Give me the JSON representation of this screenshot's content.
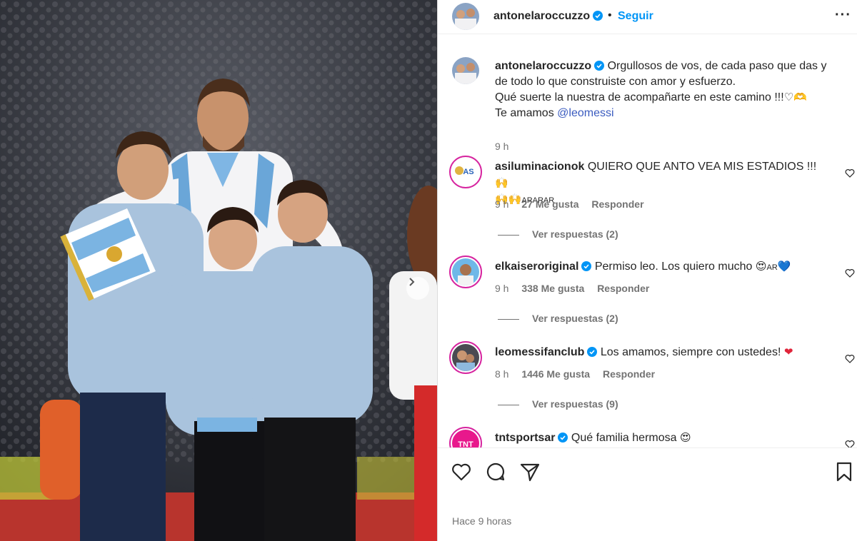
{
  "header": {
    "username": "antonelaroccuzzo",
    "dot": "•",
    "follow_label": "Seguir",
    "more_label": "···"
  },
  "caption": {
    "username": "antonelaroccuzzo",
    "line1": "Orgullosos de vos, de cada paso que das y de todo lo que construiste con amor y esfuerzo.",
    "line2": "Qué suerte la nuestra de acompañarte en este camino !!!",
    "line2_emoji": "♡🫶",
    "line3_prefix": "Te amamos ",
    "mention": "@leomessi",
    "time": "9 h"
  },
  "comments": [
    {
      "username": "asiluminacionok",
      "text": "QUIERO QUE ANTO VEA MIS ESTADIOS !!! ",
      "text2": "ARARAR",
      "time": "9 h",
      "likes": "27 Me gusta",
      "reply": "Responder",
      "replies": "Ver respuestas (2)",
      "avatar_label": "AS"
    },
    {
      "username": "elkaiseroriginal",
      "text": "Permiso leo. Los quiero mucho ",
      "text_suffix": "AR",
      "time": "9 h",
      "likes": "338 Me gusta",
      "reply": "Responder",
      "replies": "Ver respuestas (2)"
    },
    {
      "username": "leomessifanclub",
      "text": "Los amamos, siempre con ustedes! ",
      "time": "8 h",
      "likes": "1446 Me gusta",
      "reply": "Responder",
      "replies": "Ver respuestas (9)"
    },
    {
      "username": "tntsportsar",
      "text": "Qué familia hermosa ",
      "avatar_label": "TNT"
    }
  ],
  "footer": {
    "time_ago": "Hace 9 horas"
  },
  "icons": {
    "verified": "verified-badge-icon",
    "heart": "heart-icon",
    "comment": "comment-icon",
    "share": "share-icon",
    "save": "bookmark-icon",
    "next": "chevron-right-icon"
  },
  "colors": {
    "accent": "#0095f6",
    "secondary_text": "#737373",
    "mention": "#3a5bbf",
    "story_ring": "#d6249f"
  }
}
